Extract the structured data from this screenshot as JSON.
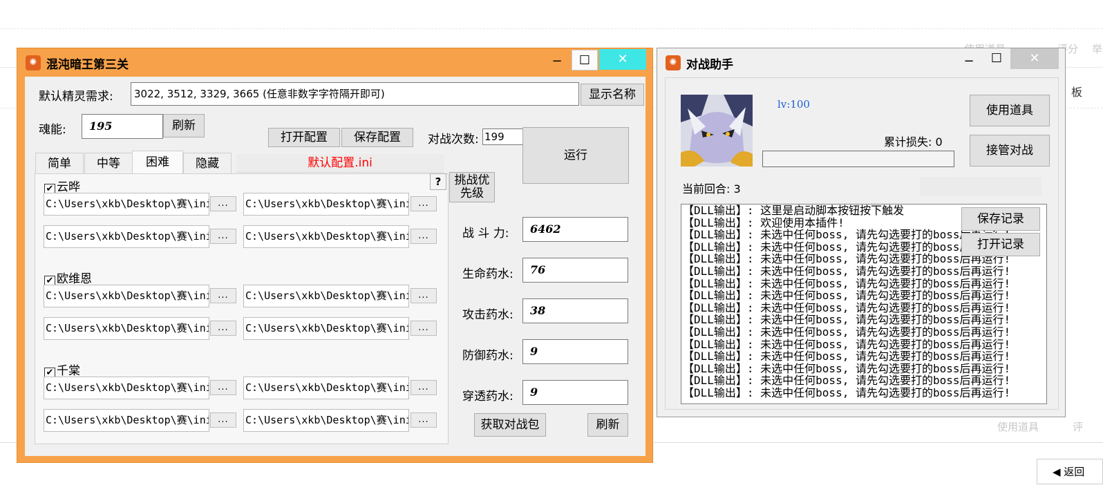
{
  "background": {
    "right_menu_top": "使用道具",
    "right_menu_top_rate": "评分",
    "right_menu_top_report": "举",
    "right_board": "板",
    "right_menu_bottom": "使用道具",
    "right_menu_bottom_rate": "评",
    "back_button": "◀ 返回"
  },
  "main_window": {
    "title": "混沌暗王第三关",
    "icon": "gear-app-icon",
    "spirit_label": "默认精灵需求:",
    "spirit_value": "3022, 3512, 3329, 3665 (任意非数字字符隔开即可)",
    "show_name_button": "显示名称",
    "soul_label": "魂能:",
    "soul_value": "195",
    "refresh_button": "刷新",
    "open_config_button": "打开配置",
    "save_config_button": "保存配置",
    "battle_count_label": "对战次数:",
    "battle_count_value": "199",
    "run_button": "运行",
    "tabs": [
      "简单",
      "中等",
      "困难",
      "隐藏"
    ],
    "active_tab": "困难",
    "config_file": "默认配置.ini",
    "help_button": "?",
    "priority_button_line1": "挑战优",
    "priority_button_line2": "先级",
    "bosses": [
      {
        "name": "云晔",
        "checked": "✔"
      },
      {
        "name": "欧维恩",
        "checked": "✔"
      },
      {
        "name": "千棠",
        "checked": "✔"
      }
    ],
    "path_value": "C:\\Users\\xkb\\Desktop\\赛\\ini",
    "browse_label": "...",
    "power_label": "战 斗 力:",
    "power_value": "6462",
    "hp_potion_label": "生命药水:",
    "hp_potion_value": "76",
    "atk_potion_label": "攻击药水:",
    "atk_potion_value": "38",
    "def_potion_label": "防御药水:",
    "def_potion_value": "9",
    "pierce_potion_label": "穿透药水:",
    "pierce_potion_value": "9",
    "get_pack_button": "获取对战包",
    "refresh_button2": "刷新"
  },
  "assistant_window": {
    "title": "对战助手",
    "level": "lv:100",
    "total_loss": "累计损失: 0",
    "use_item_button": "使用道具",
    "takeover_button": "接管对战",
    "current_round": "当前回合: 3",
    "save_log_button": "保存记录",
    "open_log_button": "打开记录",
    "log_lines": [
      "【DLL输出】: 这里是启动脚本按钮按下触发",
      "【DLL输出】: 欢迎使用本插件!",
      "【DLL输出】: 未选中任何boss, 请先勾选要打的boss后再运行!",
      "【DLL输出】: 未选中任何boss, 请先勾选要打的boss后再运行!",
      "【DLL输出】: 未选中任何boss, 请先勾选要打的boss后再运行!",
      "【DLL输出】: 未选中任何boss, 请先勾选要打的boss后再运行!",
      "【DLL输出】: 未选中任何boss, 请先勾选要打的boss后再运行!",
      "【DLL输出】: 未选中任何boss, 请先勾选要打的boss后再运行!",
      "【DLL输出】: 未选中任何boss, 请先勾选要打的boss后再运行!",
      "【DLL输出】: 未选中任何boss, 请先勾选要打的boss后再运行!",
      "【DLL输出】: 未选中任何boss, 请先勾选要打的boss后再运行!",
      "【DLL输出】: 未选中任何boss, 请先勾选要打的boss后再运行!",
      "【DLL输出】: 未选中任何boss, 请先勾选要打的boss后再运行!",
      "【DLL输出】: 未选中任何boss, 请先勾选要打的boss后再运行!",
      "【DLL输出】: 未选中任何boss, 请先勾选要打的boss后再运行!",
      "【DLL输出】: 未选中任何boss, 请先勾选要打的boss后再运行!"
    ]
  },
  "window_controls": {
    "minimize": "−",
    "maximize": "☐",
    "close": "✕"
  },
  "colors": {
    "main_frame": "#f7a24a",
    "close_active": "#3ee6e6",
    "config_file_text": "#ff0000",
    "level_text": "#1e5fd6"
  }
}
